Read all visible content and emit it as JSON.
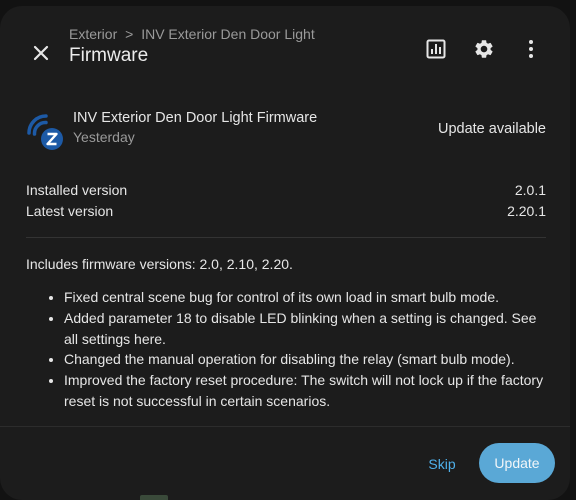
{
  "header": {
    "breadcrumb": {
      "area": "Exterior",
      "separator": ">",
      "device": "INV Exterior Den Door Light"
    },
    "title": "Firmware",
    "icons": [
      "close-icon",
      "history-chart-icon",
      "gear-icon",
      "more-vert-icon"
    ]
  },
  "firmware": {
    "name": "INV Exterior Den Door Light Firmware",
    "date": "Yesterday",
    "status": "Update available",
    "logo": "zwave-logo",
    "installed_label": "Installed version",
    "installed_value": "2.0.1",
    "latest_label": "Latest version",
    "latest_value": "2.20.1"
  },
  "notes": {
    "intro": "Includes firmware versions: 2.0, 2.10, 2.20.",
    "items": [
      "Fixed central scene bug for control of its own load in smart bulb mode.",
      "Added parameter 18 to disable LED blinking when a setting is changed. See all settings here.",
      "Changed the manual operation for disabling the relay (smart bulb mode).",
      "Improved the factory reset procedure: The switch will not lock up if the factory reset is not successful in certain scenarios."
    ]
  },
  "actions": {
    "skip": "Skip",
    "update": "Update"
  },
  "colors": {
    "accent": "#4fb0ea",
    "button": "#5aa8d6",
    "logo": "#1d5aa6"
  }
}
